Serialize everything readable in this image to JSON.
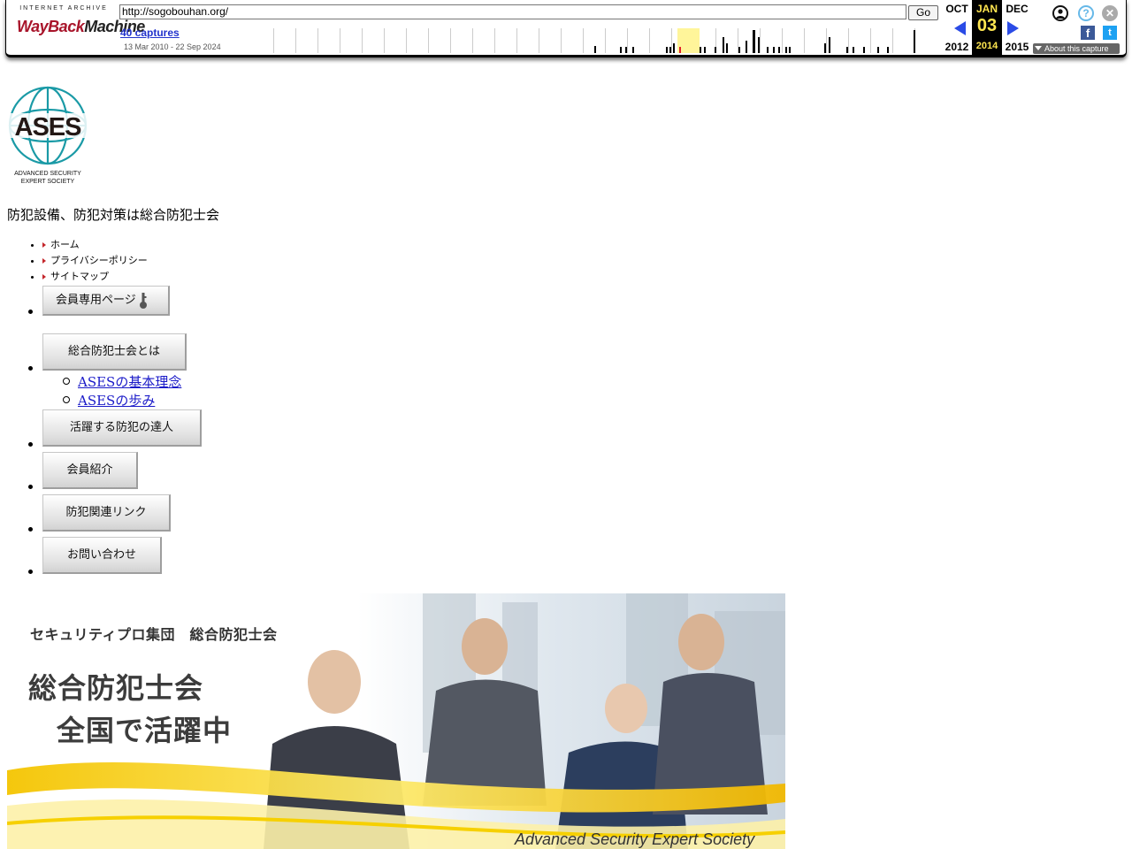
{
  "wayback": {
    "logo_top": "INTERNET ARCHIVE",
    "logo_wayback": "WayBack",
    "logo_machine": "Machine",
    "url": "http://sogobouhan.org/",
    "go_label": "Go",
    "captures": "40 captures",
    "range": "13 Mar 2010 - 22 Sep 2024",
    "prev_month": "OCT",
    "cur_month": "JAN",
    "next_month": "DEC",
    "cur_day": "03",
    "prev_year": "2012",
    "cur_year": "2014",
    "next_year": "2015",
    "about": "About this capture",
    "help_glyph": "?",
    "close_glyph": "✕",
    "facebook_glyph": "f",
    "twitter_glyph": "t",
    "highlight_color": "#fff59a"
  },
  "site": {
    "logo_text": "ASES",
    "logo_org_line1": "ADVANCED SECURITY",
    "logo_org_line2": "EXPERT SOCIETY",
    "tagline": "防犯設備、防犯対策は総合防犯士会",
    "top_nav": [
      "ホーム",
      "プライバシーポリシー",
      "サイトマップ"
    ],
    "member_button": "会員専用ページ",
    "main_nav": [
      {
        "label": "総合防犯士会とは"
      },
      {
        "label": "活躍する防犯の達人"
      },
      {
        "label": "会員紹介"
      },
      {
        "label": "防犯関連リンク"
      },
      {
        "label": "お問い合わせ"
      }
    ],
    "sub_nav": [
      "ASESの基本理念",
      "ASESの歩み"
    ],
    "hero": {
      "subtitle": "セキュリティプロ集団　総合防犯士会",
      "headline1": "総合防犯士会",
      "headline2": "全国で活躍中",
      "english": "Advanced Security Expert Society"
    }
  }
}
